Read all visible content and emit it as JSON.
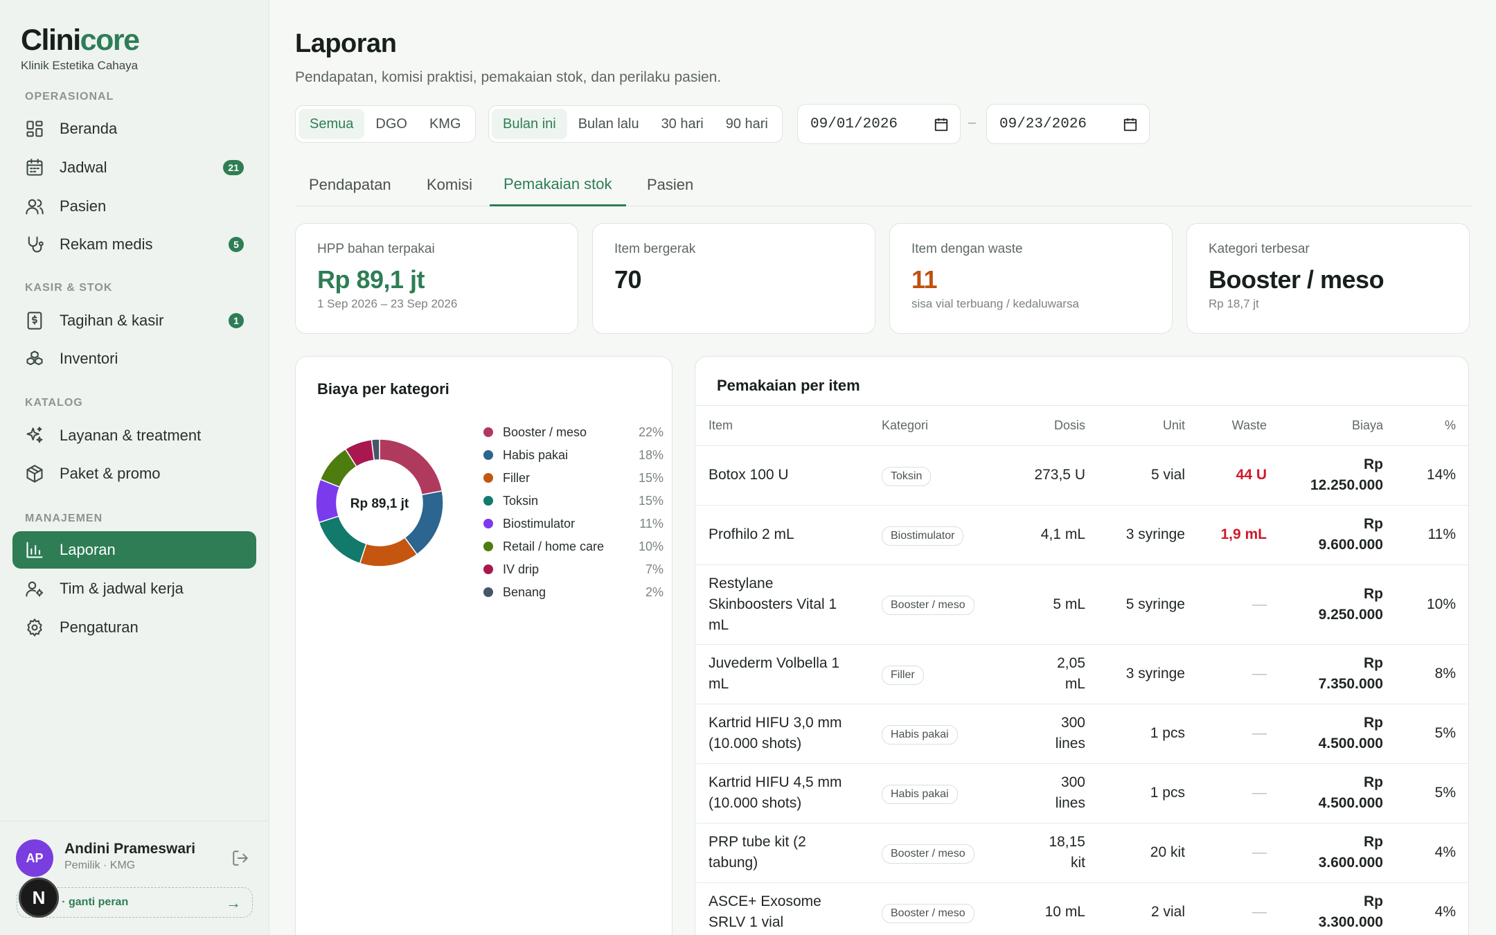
{
  "brand": {
    "name_main": "Clini",
    "name_accent": "core",
    "subtitle": "Klinik Estetika Cahaya"
  },
  "sidebar": {
    "sections": {
      "operasional": "OPERASIONAL",
      "kasir": "KASIR & STOK",
      "katalog": "KATALOG",
      "manajemen": "MANAJEMEN"
    },
    "items": [
      {
        "label": "Beranda",
        "icon": "grid-icon"
      },
      {
        "label": "Jadwal",
        "icon": "calendar-icon",
        "badge": "21"
      },
      {
        "label": "Pasien",
        "icon": "users-icon"
      },
      {
        "label": "Rekam medis",
        "icon": "stethoscope-icon",
        "badge": "5"
      },
      {
        "label": "Tagihan & kasir",
        "icon": "receipt-icon",
        "badge": "1"
      },
      {
        "label": "Inventori",
        "icon": "boxes-icon"
      },
      {
        "label": "Layanan & treatment",
        "icon": "sparkle-icon"
      },
      {
        "label": "Paket & promo",
        "icon": "package-icon"
      },
      {
        "label": "Laporan",
        "icon": "bar-chart-icon",
        "active": true
      },
      {
        "label": "Tim & jadwal kerja",
        "icon": "user-cog-icon"
      },
      {
        "label": "Pengaturan",
        "icon": "gear-icon"
      }
    ],
    "user": {
      "initials": "AP",
      "name": "Andini Prameswari",
      "role": "Pemilik · KMG",
      "switch_label": "o · ganti peran",
      "switch_arrow": "→"
    },
    "floating_badge": "N"
  },
  "page": {
    "title": "Laporan",
    "subtitle": "Pendapatan, komisi praktisi, pemakaian stok, dan perilaku pasien."
  },
  "filters": {
    "branches": [
      "Semua",
      "DGO",
      "KMG"
    ],
    "branch_selected": 0,
    "periods": [
      "Bulan ini",
      "Bulan lalu",
      "30 hari",
      "90 hari"
    ],
    "period_selected": 0,
    "date_from": "09/01/2026",
    "date_to": "09/23/2026",
    "date_separator": "–"
  },
  "tabs": [
    "Pendapatan",
    "Komisi",
    "Pemakaian stok",
    "Pasien"
  ],
  "tab_selected": 2,
  "kpis": [
    {
      "label": "HPP bahan terpakai",
      "value": "Rp 89,1 jt",
      "sub": "1 Sep 2026 – 23 Sep 2026",
      "color": "#2e7d55"
    },
    {
      "label": "Item bergerak",
      "value": "70",
      "sub": "",
      "color": "#18201b"
    },
    {
      "label": "Item dengan waste",
      "value": "11",
      "sub": "sisa vial terbuang / kedaluwarsa",
      "color": "#c0500f"
    },
    {
      "label": "Kategori terbesar",
      "value": "Booster / meso",
      "sub": "Rp 18,7 jt",
      "color": "#18201b"
    }
  ],
  "chart_data": {
    "type": "pie",
    "title": "Biaya per kategori",
    "center_label": "Rp 89,1 jt",
    "categories": [
      "Booster / meso",
      "Habis pakai",
      "Filler",
      "Toksin",
      "Biostimulator",
      "Retail / home care",
      "IV drip",
      "Benang"
    ],
    "values": [
      22,
      18,
      15,
      15,
      11,
      10,
      7,
      2
    ],
    "labels": [
      "22%",
      "18%",
      "15%",
      "15%",
      "11%",
      "10%",
      "7%",
      "2%"
    ],
    "colors": [
      "#b03a5e",
      "#2b6590",
      "#c4560f",
      "#127a6b",
      "#7c3aed",
      "#4d7c0f",
      "#a8174e",
      "#475569"
    ],
    "legend_position": "right"
  },
  "usage": {
    "title": "Pemakaian per item",
    "columns": [
      "Item",
      "Kategori",
      "Dosis",
      "Unit",
      "Waste",
      "Biaya",
      "%"
    ],
    "rows": [
      {
        "item": "Botox 100 U",
        "kategori": "Toksin",
        "dosis": "273,5 U",
        "unit": "5 vial",
        "waste": "44 U",
        "biaya_a": "Rp",
        "biaya_b": "12.250.000",
        "pct": "14%"
      },
      {
        "item": "Profhilo 2 mL",
        "kategori": "Biostimulator",
        "dosis": "4,1 mL",
        "unit": "3 syringe",
        "waste": "1,9 mL",
        "biaya_a": "Rp",
        "biaya_b": "9.600.000",
        "pct": "11%"
      },
      {
        "item": "Restylane Skinboosters Vital 1 mL",
        "kategori": "Booster / meso",
        "dosis": "5 mL",
        "unit": "5 syringe",
        "waste": "—",
        "biaya_a": "Rp",
        "biaya_b": "9.250.000",
        "pct": "10%"
      },
      {
        "item": "Juvederm Volbella 1 mL",
        "kategori": "Filler",
        "dosis": "2,05 mL",
        "unit": "3 syringe",
        "waste": "—",
        "biaya_a": "Rp",
        "biaya_b": "7.350.000",
        "pct": "8%"
      },
      {
        "item": "Kartrid HIFU 3,0 mm (10.000 shots)",
        "kategori": "Habis pakai",
        "dosis": "300 lines",
        "unit": "1 pcs",
        "waste": "—",
        "biaya_a": "Rp",
        "biaya_b": "4.500.000",
        "pct": "5%"
      },
      {
        "item": "Kartrid HIFU 4,5 mm (10.000 shots)",
        "kategori": "Habis pakai",
        "dosis": "300 lines",
        "unit": "1 pcs",
        "waste": "—",
        "biaya_a": "Rp",
        "biaya_b": "4.500.000",
        "pct": "5%"
      },
      {
        "item": "PRP tube kit (2 tabung)",
        "kategori": "Booster / meso",
        "dosis": "18,15 kit",
        "unit": "20 kit",
        "waste": "—",
        "biaya_a": "Rp",
        "biaya_b": "3.600.000",
        "pct": "4%"
      },
      {
        "item": "ASCE+ Exosome SRLV 1 vial",
        "kategori": "Booster / meso",
        "dosis": "10 mL",
        "unit": "2 vial",
        "waste": "—",
        "biaya_a": "Rp",
        "biaya_b": "3.300.000",
        "pct": "4%"
      }
    ]
  }
}
